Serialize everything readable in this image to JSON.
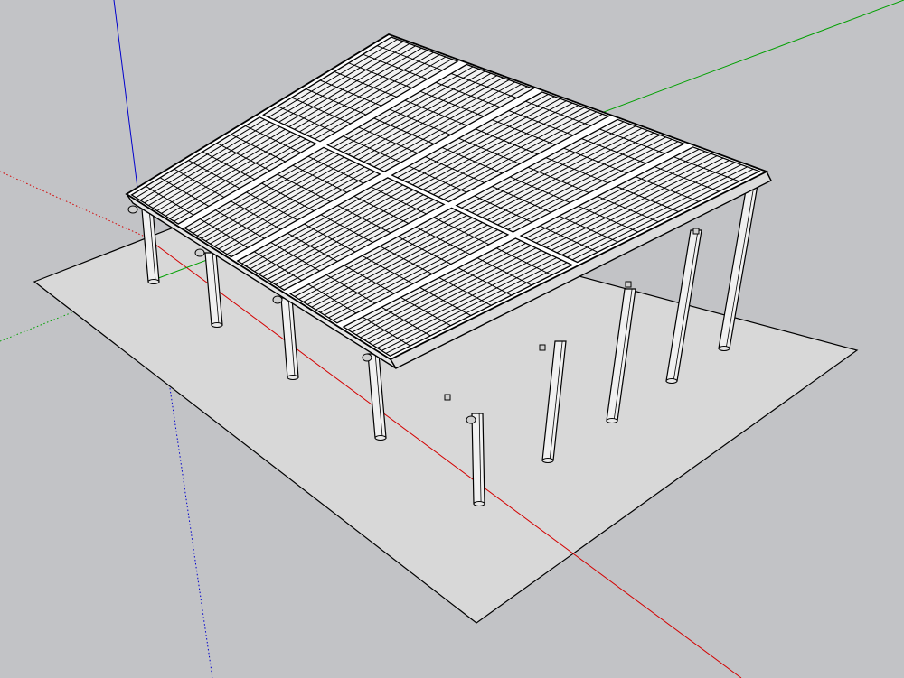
{
  "app": {
    "type": "3d-modeling-viewport",
    "background_color": "#c2c3c6"
  },
  "scene": {
    "model": "solar-carport",
    "panel_columns": 2,
    "panel_rows": 5,
    "cell_columns": 9,
    "cell_rows": 11,
    "support_posts_front": 5,
    "support_posts_back": 5,
    "ground_color": "#d8d8d8",
    "panel_fill": "#f2f2f2",
    "line_color": "#000000"
  },
  "axes": {
    "red": "#d40000",
    "green": "#00a000",
    "blue": "#0000cc"
  }
}
